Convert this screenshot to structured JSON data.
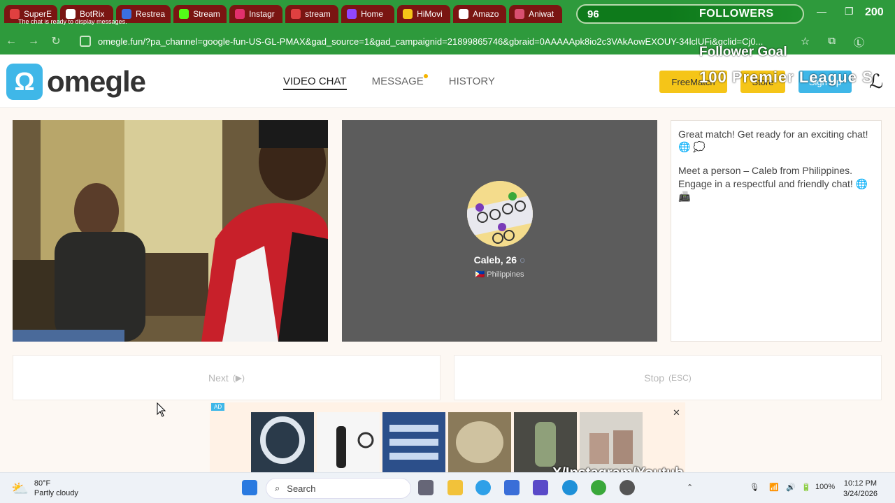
{
  "browser": {
    "tabs": [
      {
        "label": "SuperE",
        "color": "#e04040"
      },
      {
        "label": "BotRix",
        "color": "#ffffff"
      },
      {
        "label": "Restrea",
        "color": "#3b6fe0"
      },
      {
        "label": "Stream",
        "color": "#53fc18"
      },
      {
        "label": "Instagr",
        "color": "#e1306c"
      },
      {
        "label": "stream",
        "color": "#e04040"
      },
      {
        "label": "Home",
        "color": "#9146ff"
      },
      {
        "label": "HiMovi",
        "color": "#f5c518"
      },
      {
        "label": "Amazo",
        "color": "#ffffff"
      },
      {
        "label": "Aniwat",
        "color": "#d94f70"
      }
    ],
    "tab_overlay_text": "The chat is ready to display messages.",
    "url": "omegle.fun/?pa_channel=google-fun-US-GL-PMAX&gad_source=1&gad_campaignid=21899865746&gbraid=0AAAAApk8io2c3VAkAowEXOUY-34lclUFi&gclid=Cj0..."
  },
  "stream_overlay": {
    "followers_current": "96",
    "followers_label": "FOLLOWERS",
    "followers_goal": "200",
    "follower_goal_title": "Follower Goal",
    "premier_text": "100 Premier League S",
    "social_text": "X/Instagram/Youtub"
  },
  "header": {
    "logo_text": "omegle",
    "nav": {
      "video_chat": "VIDEO CHAT",
      "message": "MESSAGE",
      "history": "HISTORY"
    },
    "buttons": {
      "freematch": "FreeMatch",
      "store": "Store",
      "signup": "Sign Up"
    }
  },
  "remote": {
    "name": "Caleb, 26",
    "country_flag": "🇵🇭",
    "country": "Philippines"
  },
  "chat": {
    "messages": [
      "Great match! Get ready for an exciting chat! 🌐 💭",
      "Meet a person – Caleb from Philippines. Engage in a respectful and friendly chat! 🌐 📠"
    ]
  },
  "controls": {
    "next": "Next",
    "next_hint": "(▶)",
    "stop": "Stop",
    "stop_hint": "(ESC)"
  },
  "ad": {
    "badge": "AD",
    "close": "✕"
  },
  "taskbar": {
    "temp": "80°F",
    "weather": "Partly cloudy",
    "search_placeholder": "Search",
    "battery": "100%",
    "time": "10:12 PM",
    "date": "3/24/2026"
  }
}
